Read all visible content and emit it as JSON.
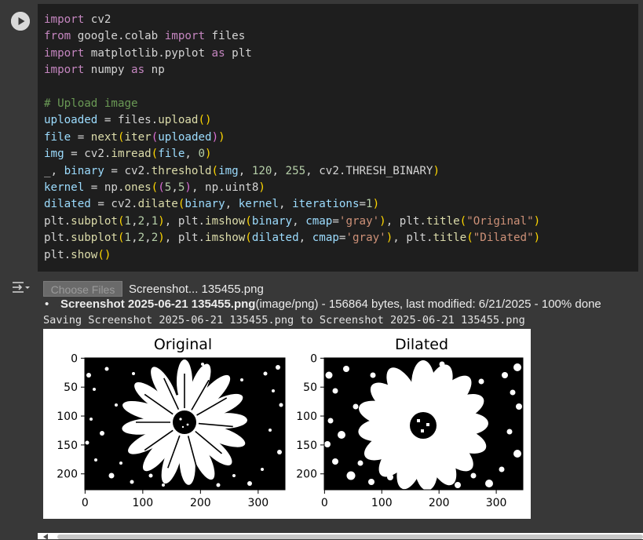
{
  "code_cell": {
    "run_icon": "play-circle-icon",
    "lines": {
      "l1": {
        "a": "import",
        "b": " cv2"
      },
      "l2": {
        "a": "from",
        "b": " google.colab ",
        "c": "import",
        "d": " files"
      },
      "l3": {
        "a": "import",
        "b": " matplotlib.pyplot ",
        "c": "as",
        "d": " plt"
      },
      "l4": {
        "a": "import",
        "b": " numpy ",
        "c": "as",
        "d": " np"
      },
      "l6": "# Upload image",
      "l7": {
        "a": "uploaded",
        "b": " = files.",
        "c": "upload",
        "d": "(",
        "e": ")"
      },
      "l8": {
        "a": "file",
        "b": " = ",
        "c": "next",
        "d": "(",
        "e": "iter",
        "f": "(",
        "g": "uploaded",
        "h": ")",
        "i": ")"
      },
      "l9": {
        "a": "img",
        "b": " = cv2.",
        "c": "imread",
        "d": "(",
        "e": "file",
        "f": ", ",
        "g": "0",
        "h": ")"
      },
      "l10": {
        "a": "_, ",
        "b": "binary",
        "c": " = cv2.",
        "d": "threshold",
        "e": "(",
        "f": "img",
        "g": ", ",
        "h": "120",
        "i": ", ",
        "j": "255",
        "k": ", cv2.THRESH_BINARY",
        "l": ")"
      },
      "l11": {
        "a": "kernel",
        "b": " = np.",
        "c": "ones",
        "d": "(",
        "e": "(",
        "f": "5",
        "g": ",",
        "h": "5",
        "i": ")",
        "j": ", np.uint8",
        "k": ")"
      },
      "l12": {
        "a": "dilated",
        "b": " = cv2.",
        "c": "dilate",
        "d": "(",
        "e": "binary",
        "f": ", ",
        "g": "kernel",
        "h": ", ",
        "i": "iterations",
        "j": "=",
        "k": "1",
        "l": ")"
      },
      "l13": {
        "a": "plt.",
        "b": "subplot",
        "c": "(",
        "d": "1",
        "e": ",",
        "f": "2",
        "g": ",",
        "h": "1",
        "i": ")",
        "j": ", plt.",
        "k": "imshow",
        "l": "(",
        "m": "binary",
        "n": ", ",
        "o": "cmap",
        "p": "=",
        "q": "'gray'",
        "r": ")",
        "s": ", plt.",
        "t": "title",
        "u": "(",
        "v": "\"Original\"",
        "w": ")"
      },
      "l14": {
        "a": "plt.",
        "b": "subplot",
        "c": "(",
        "d": "1",
        "e": ",",
        "f": "2",
        "g": ",",
        "h": "2",
        "i": ")",
        "j": ", plt.",
        "k": "imshow",
        "l": "(",
        "m": "dilated",
        "n": ", ",
        "o": "cmap",
        "p": "=",
        "q": "'gray'",
        "r": ")",
        "s": ", plt.",
        "t": "title",
        "u": "(",
        "v": "\"Dilated\"",
        "w": ")"
      },
      "l15": {
        "a": "plt.",
        "b": "show",
        "c": "(",
        "d": ")"
      }
    }
  },
  "output": {
    "toggle_icon": "output-collapse-icon",
    "choose_files_label": "Choose Files",
    "selected_file": "Screenshot... 135455.png",
    "upload_filename": "Screenshot 2025-06-21 135455.png",
    "upload_details": "(image/png) - 156864 bytes, last modified: 6/21/2025 - 100% done",
    "saving_text": "Saving Screenshot 2025-06-21 135455.png to Screenshot 2025-06-21 135455.png"
  },
  "figure": {
    "panels": [
      {
        "title": "Original",
        "image": "binary flower (white petals, black center) on black background"
      },
      {
        "title": "Dilated",
        "image": "dilated binary flower with merged white petals"
      }
    ],
    "x_ticks": [
      "0",
      "100",
      "200",
      "300"
    ],
    "y_ticks": [
      "0",
      "50",
      "100",
      "150",
      "200"
    ],
    "colors": {
      "foreground": "#ffffff",
      "background": "#000000",
      "axes": "#000000"
    }
  }
}
